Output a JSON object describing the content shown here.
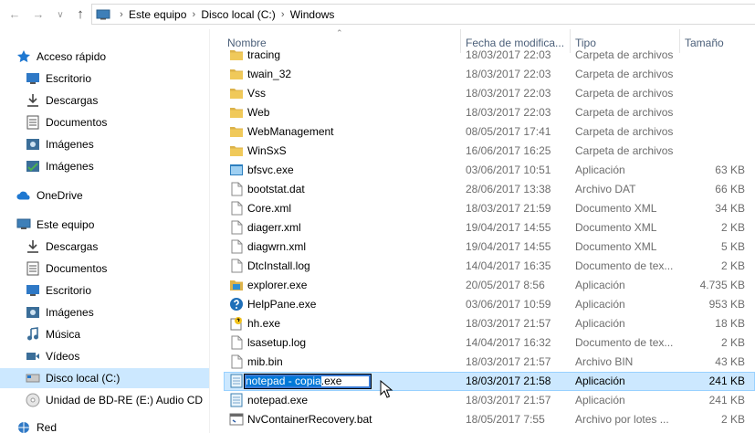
{
  "address": {
    "crumbs": [
      "Este equipo",
      "Disco local (C:)",
      "Windows"
    ]
  },
  "nav": {
    "items": [
      {
        "label": "Acceso rápido",
        "icon": "star-icon",
        "level": 0
      },
      {
        "label": "Escritorio",
        "icon": "desktop-icon",
        "level": 1
      },
      {
        "label": "Descargas",
        "icon": "download-icon",
        "level": 1
      },
      {
        "label": "Documentos",
        "icon": "documents-icon",
        "level": 1
      },
      {
        "label": "Imágenes",
        "icon": "pictures-icon",
        "level": 1
      },
      {
        "label": "Imágenes",
        "icon": "pictures-green-icon",
        "level": 1
      },
      {
        "label": "OneDrive",
        "icon": "onedrive-icon",
        "level": 0
      },
      {
        "label": "Este equipo",
        "icon": "computer-icon",
        "level": 0
      },
      {
        "label": "Descargas",
        "icon": "download-icon",
        "level": 1
      },
      {
        "label": "Documentos",
        "icon": "documents-icon",
        "level": 1
      },
      {
        "label": "Escritorio",
        "icon": "desktop-icon",
        "level": 1
      },
      {
        "label": "Imágenes",
        "icon": "pictures-icon",
        "level": 1
      },
      {
        "label": "Música",
        "icon": "music-icon",
        "level": 1
      },
      {
        "label": "Vídeos",
        "icon": "videos-icon",
        "level": 1
      },
      {
        "label": "Disco local (C:)",
        "icon": "drive-icon",
        "level": 1,
        "selected": true
      },
      {
        "label": "Unidad de BD-RE (E:) Audio CD",
        "icon": "cd-icon",
        "level": 1
      },
      {
        "label": "Red",
        "icon": "network-icon",
        "level": 0
      }
    ]
  },
  "columns": {
    "name": "Nombre",
    "date": "Fecha de modifica...",
    "type": "Tipo",
    "size": "Tamaño"
  },
  "files": [
    {
      "name": "tracing",
      "date": "18/03/2017 22:03",
      "type": "Carpeta de archivos",
      "size": "",
      "icon": "folder-icon"
    },
    {
      "name": "twain_32",
      "date": "18/03/2017 22:03",
      "type": "Carpeta de archivos",
      "size": "",
      "icon": "folder-icon"
    },
    {
      "name": "Vss",
      "date": "18/03/2017 22:03",
      "type": "Carpeta de archivos",
      "size": "",
      "icon": "folder-icon"
    },
    {
      "name": "Web",
      "date": "18/03/2017 22:03",
      "type": "Carpeta de archivos",
      "size": "",
      "icon": "folder-icon"
    },
    {
      "name": "WebManagement",
      "date": "08/05/2017 17:41",
      "type": "Carpeta de archivos",
      "size": "",
      "icon": "folder-icon"
    },
    {
      "name": "WinSxS",
      "date": "16/06/2017 16:25",
      "type": "Carpeta de archivos",
      "size": "",
      "icon": "folder-icon"
    },
    {
      "name": "bfsvc.exe",
      "date": "03/06/2017 10:51",
      "type": "Aplicación",
      "size": "63 KB",
      "icon": "exe-icon"
    },
    {
      "name": "bootstat.dat",
      "date": "28/06/2017 13:38",
      "type": "Archivo DAT",
      "size": "66 KB",
      "icon": "file-icon"
    },
    {
      "name": "Core.xml",
      "date": "18/03/2017 21:59",
      "type": "Documento XML",
      "size": "34 KB",
      "icon": "file-icon"
    },
    {
      "name": "diagerr.xml",
      "date": "19/04/2017 14:55",
      "type": "Documento XML",
      "size": "2 KB",
      "icon": "file-icon"
    },
    {
      "name": "diagwrn.xml",
      "date": "19/04/2017 14:55",
      "type": "Documento XML",
      "size": "5 KB",
      "icon": "file-icon"
    },
    {
      "name": "DtcInstall.log",
      "date": "14/04/2017 16:35",
      "type": "Documento de tex...",
      "size": "2 KB",
      "icon": "file-icon"
    },
    {
      "name": "explorer.exe",
      "date": "20/05/2017 8:56",
      "type": "Aplicación",
      "size": "4.735 KB",
      "icon": "explorer-icon"
    },
    {
      "name": "HelpPane.exe",
      "date": "03/06/2017 10:59",
      "type": "Aplicación",
      "size": "953 KB",
      "icon": "help-icon"
    },
    {
      "name": "hh.exe",
      "date": "18/03/2017 21:57",
      "type": "Aplicación",
      "size": "18 KB",
      "icon": "hh-icon"
    },
    {
      "name": "lsasetup.log",
      "date": "14/04/2017 16:32",
      "type": "Documento de tex...",
      "size": "2 KB",
      "icon": "file-icon"
    },
    {
      "name": "mib.bin",
      "date": "18/03/2017 21:57",
      "type": "Archivo BIN",
      "size": "43 KB",
      "icon": "file-icon"
    },
    {
      "name": "notepad - copia.exe",
      "date": "18/03/2017 21:58",
      "type": "Aplicación",
      "size": "241 KB",
      "icon": "notepad-icon",
      "selected": true,
      "rename": {
        "selected_part": "notepad - copia",
        "rest": ".exe"
      }
    },
    {
      "name": "notepad.exe",
      "date": "18/03/2017 21:57",
      "type": "Aplicación",
      "size": "241 KB",
      "icon": "notepad-icon"
    },
    {
      "name": "NvContainerRecovery.bat",
      "date": "18/05/2017 7:55",
      "type": "Archivo por lotes ...",
      "size": "2 KB",
      "icon": "bat-icon"
    }
  ],
  "colors": {
    "selection": "#cce8ff",
    "header_text": "#4c607a",
    "detail_text": "#6d6d6d",
    "folder": "#dcb24a",
    "rename_highlight": "#0078d7"
  }
}
